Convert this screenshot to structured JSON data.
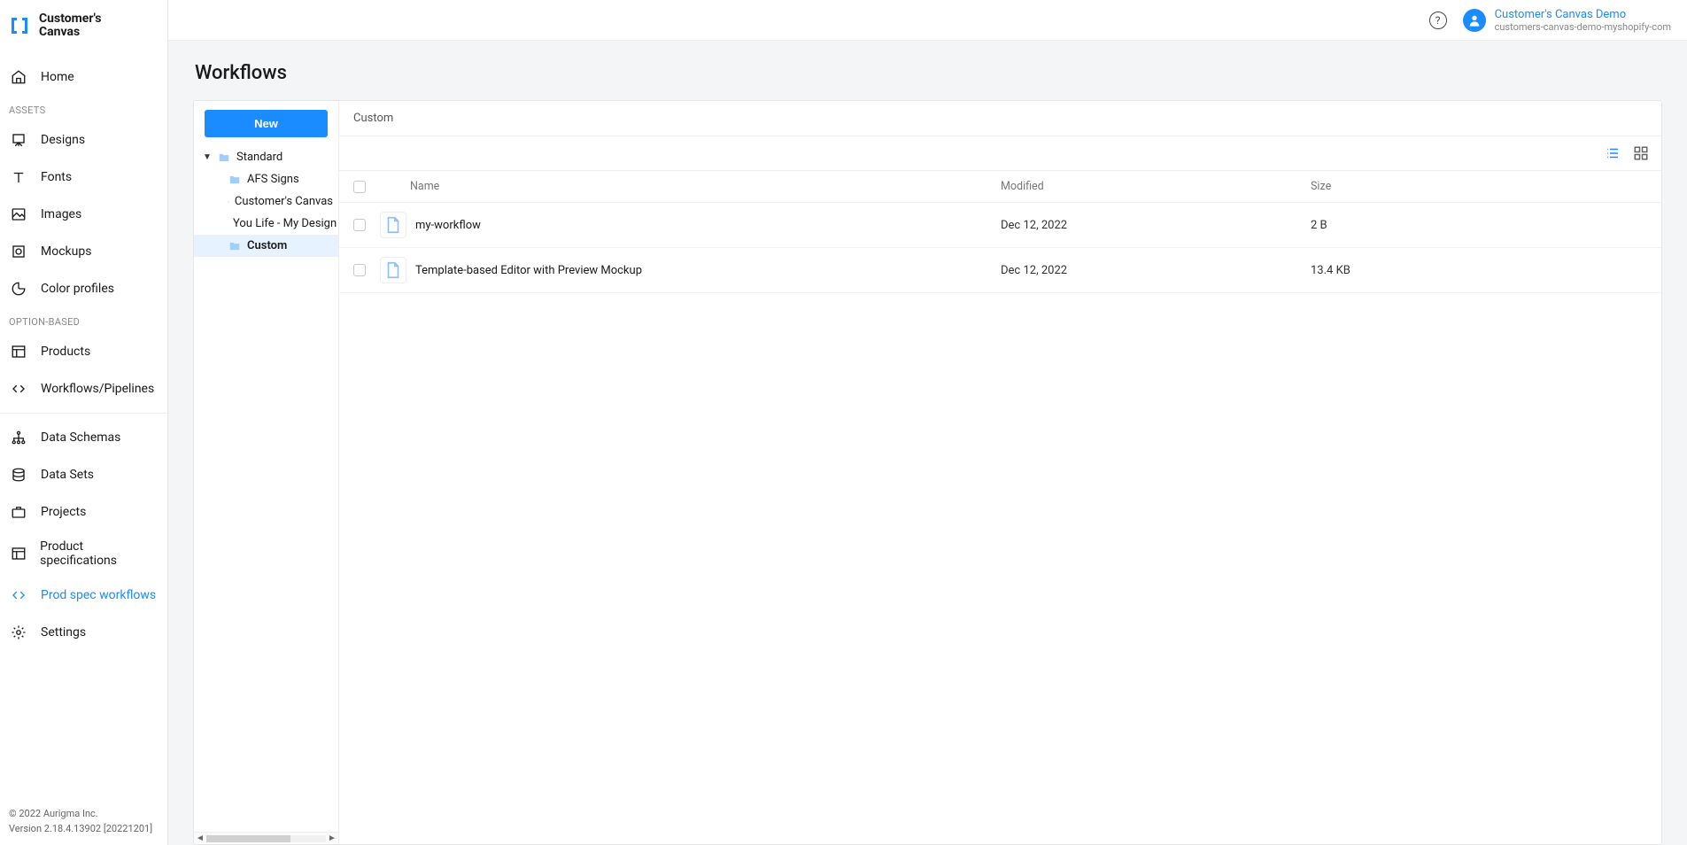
{
  "brand": {
    "line1": "Customer's",
    "line2": "Canvas"
  },
  "header": {
    "user_name": "Customer's Canvas Demo",
    "user_tenant": "customers-canvas-demo-myshopify-com"
  },
  "sidebar": {
    "home": "Home",
    "section_assets": "ASSETS",
    "designs": "Designs",
    "fonts": "Fonts",
    "images": "Images",
    "mockups": "Mockups",
    "color_profiles": "Color profiles",
    "section_option": "OPTION-BASED",
    "products": "Products",
    "workflows_pipelines": "Workflows/Pipelines",
    "data_schemas": "Data Schemas",
    "data_sets": "Data Sets",
    "projects": "Projects",
    "product_specs": "Product specifications",
    "prod_spec_workflows": "Prod spec workflows",
    "settings": "Settings"
  },
  "footer": {
    "copyright": "© 2022 Aurigma Inc.",
    "version": "Version 2.18.4.13902 [20221201]"
  },
  "page": {
    "title": "Workflows",
    "new_button": "New",
    "breadcrumb": "Custom"
  },
  "tree": {
    "root": "Standard",
    "children": [
      "AFS Signs",
      "Customer's Canvas",
      "You Life - My Design",
      "Custom"
    ],
    "selected_index": 3
  },
  "table": {
    "headers": {
      "name": "Name",
      "modified": "Modified",
      "size": "Size"
    },
    "rows": [
      {
        "name": "my-workflow",
        "modified": "Dec 12, 2022",
        "size": "2 B"
      },
      {
        "name": "Template-based Editor with Preview Mockup",
        "modified": "Dec 12, 2022",
        "size": "13.4 KB"
      }
    ]
  }
}
